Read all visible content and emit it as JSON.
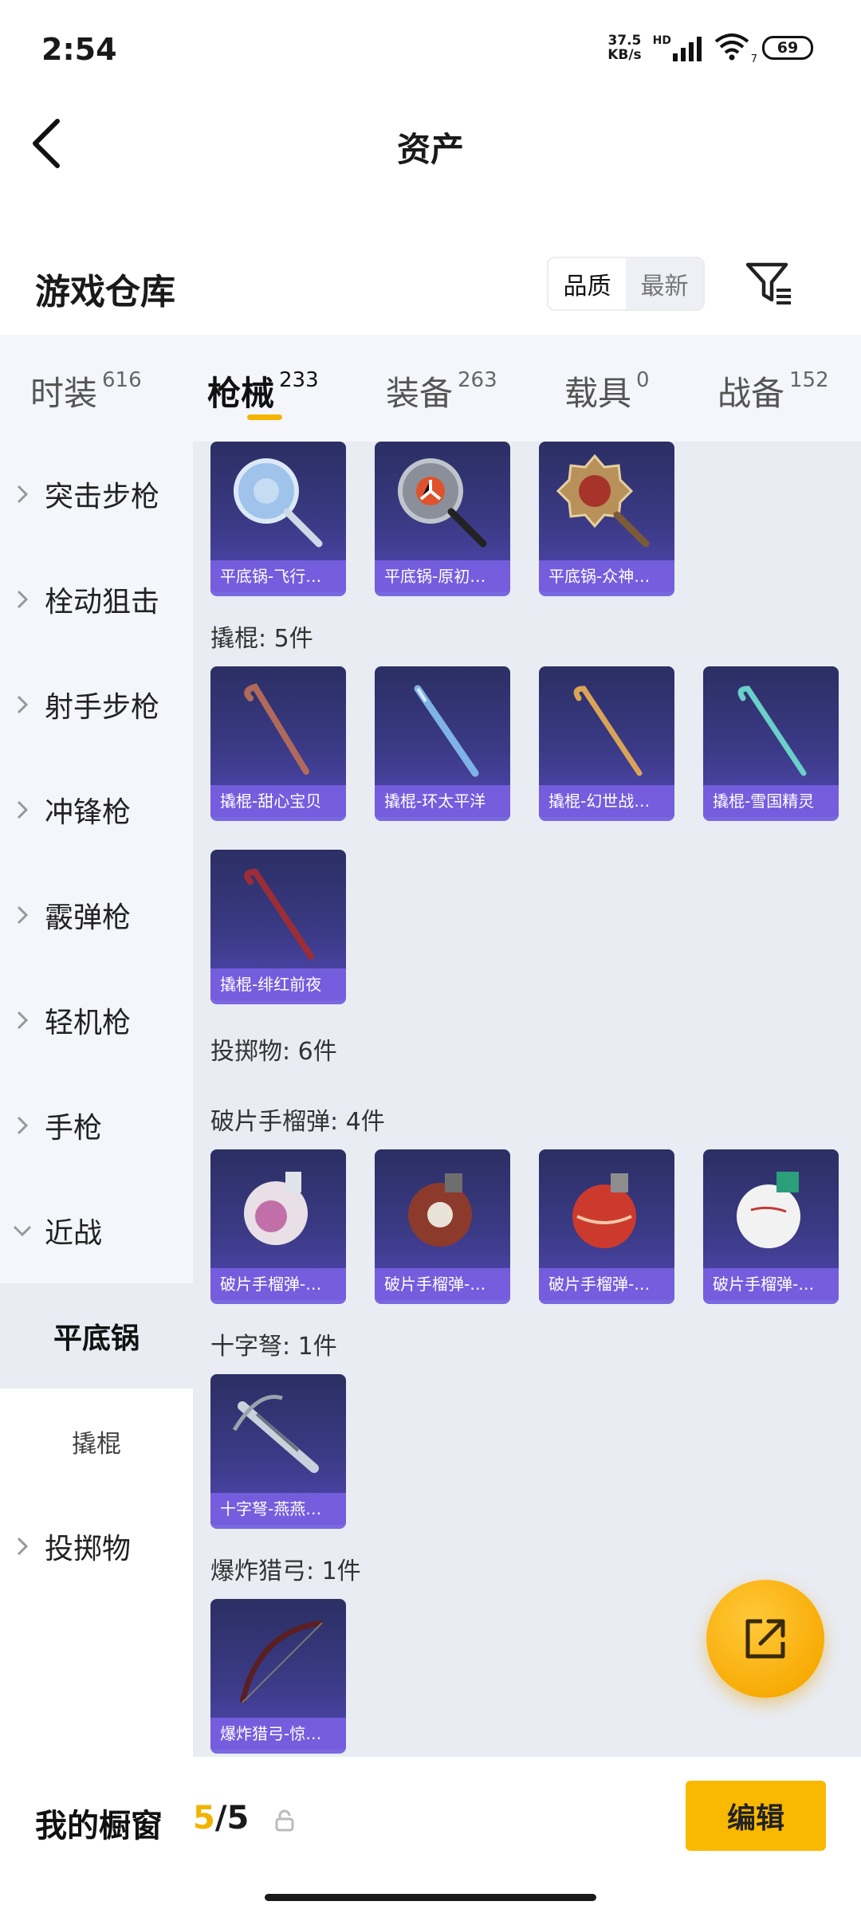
{
  "status": {
    "time": "2:54",
    "net_speed_value": "37.5",
    "net_speed_unit": "KB/s",
    "network": "HD",
    "wifi_badge": "7",
    "battery": "69"
  },
  "header": {
    "title": "资产",
    "back_icon": "chevron-left-icon"
  },
  "warehouse": {
    "title": "游戏仓库",
    "sort_options": [
      "品质",
      "最新"
    ],
    "active_sort": "品质",
    "filter_icon": "filter-icon"
  },
  "category_tabs": [
    {
      "label": "时装",
      "count": "616"
    },
    {
      "label": "枪械",
      "count": "233",
      "active": true
    },
    {
      "label": "装备",
      "count": "263"
    },
    {
      "label": "载具",
      "count": "0"
    },
    {
      "label": "战备",
      "count": "152"
    }
  ],
  "sidebar": {
    "items": [
      "突击步枪",
      "栓动狙击",
      "射手步枪",
      "冲锋枪",
      "霰弹枪",
      "轻机枪",
      "手枪",
      "近战",
      "投掷物"
    ],
    "subitems": [
      "平底锅",
      "撬棍"
    ],
    "active_subitem": "平底锅"
  },
  "content": {
    "pan_items": [
      "平底锅-飞行…",
      "平底锅-原初…",
      "平底锅-众神…"
    ],
    "crowbar_group": "撬棍: 5件",
    "crowbar_items": [
      "撬棍-甜心宝贝",
      "撬棍-环太平洋",
      "撬棍-幻世战…",
      "撬棍-雪国精灵",
      "撬棍-绯红前夜"
    ],
    "throwable_group": "投掷物: 6件",
    "grenade_group": "破片手榴弹: 4件",
    "grenade_items": [
      "破片手榴弹-…",
      "破片手榴弹-…",
      "破片手榴弹-…",
      "破片手榴弹-…"
    ],
    "crossbow_group": "十字弩: 1件",
    "crossbow_items": [
      "十字弩-燕燕…"
    ],
    "bow_group": "爆炸猎弓: 1件",
    "bow_items": [
      "爆炸猎弓-惊…"
    ]
  },
  "fab": {
    "icon": "share-external-icon"
  },
  "bottom": {
    "label": "我的橱窗",
    "count_current": "5",
    "count_sep": "/",
    "count_total": "5",
    "lock_icon": "lock-icon",
    "edit_label": "编辑"
  },
  "colors": {
    "accent": "#f8b900",
    "card_bg": "#3b3a86",
    "card_caption": "#7860e2",
    "sidebar_bg": "#f4f6fb",
    "content_bg": "#e9ecf3"
  }
}
